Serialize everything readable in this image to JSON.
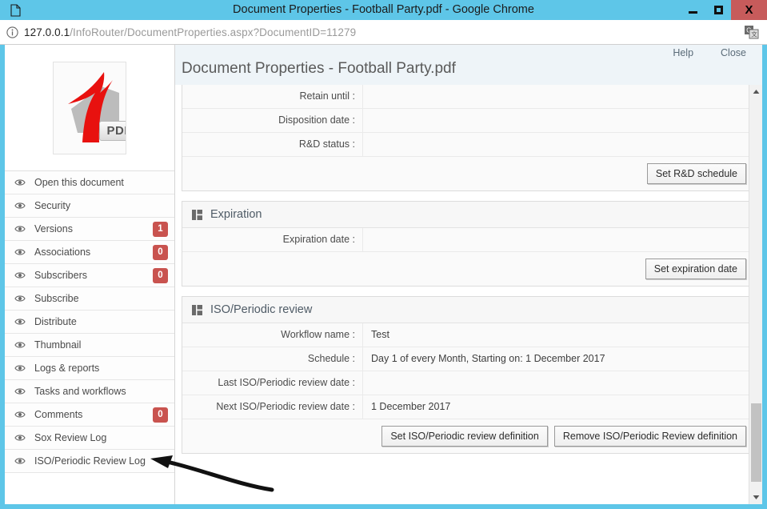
{
  "browser": {
    "window_title": "Document Properties - Football Party.pdf - Google Chrome",
    "tab_icon": "document-icon",
    "minimize_label": "",
    "maximize_label": "",
    "close_label": "X",
    "url_host": "127.0.0.1",
    "url_path": "/InfoRouter/DocumentProperties.aspx?DocumentID=11279",
    "url_info_icon": "info-circle-icon",
    "url_right_icon": "translate-icon",
    "titlebar_color": "#5ec6e8",
    "close_button_color": "#c75b5b"
  },
  "sidebar": {
    "thumbnail": {
      "type": "pdf-thumbnail",
      "badge_label": "PDF"
    },
    "items": [
      {
        "label": "Open this document",
        "icon": "eye-icon",
        "badge": null
      },
      {
        "label": "Security",
        "icon": "eye-icon",
        "badge": null
      },
      {
        "label": "Versions",
        "icon": "eye-icon",
        "badge": "1"
      },
      {
        "label": "Associations",
        "icon": "eye-icon",
        "badge": "0"
      },
      {
        "label": "Subscribers",
        "icon": "eye-icon",
        "badge": "0"
      },
      {
        "label": "Subscribe",
        "icon": "eye-icon",
        "badge": null
      },
      {
        "label": "Distribute",
        "icon": "eye-icon",
        "badge": null
      },
      {
        "label": "Thumbnail",
        "icon": "eye-icon",
        "badge": null
      },
      {
        "label": "Logs & reports",
        "icon": "eye-icon",
        "badge": null
      },
      {
        "label": "Tasks and workflows",
        "icon": "eye-icon",
        "badge": null
      },
      {
        "label": "Comments",
        "icon": "eye-icon",
        "badge": "0"
      },
      {
        "label": "Sox Review Log",
        "icon": "eye-icon",
        "badge": null
      },
      {
        "label": "ISO/Periodic Review Log",
        "icon": "eye-icon",
        "badge": null
      }
    ],
    "badge_color": "#c9534f"
  },
  "header": {
    "title": "Document Properties - Football Party.pdf",
    "help_label": "Help",
    "close_label": "Close"
  },
  "panels": {
    "retention": {
      "rows": [
        {
          "label": "Retain until :",
          "value": ""
        },
        {
          "label": "Disposition date :",
          "value": ""
        },
        {
          "label": "R&D status :",
          "value": ""
        }
      ],
      "buttons": [
        "Set R&D schedule"
      ]
    },
    "expiration": {
      "title": "Expiration",
      "icon": "panel-grid-icon",
      "rows": [
        {
          "label": "Expiration date :",
          "value": ""
        }
      ],
      "buttons": [
        "Set expiration date"
      ]
    },
    "iso_review": {
      "title": "ISO/Periodic review",
      "icon": "panel-grid-icon",
      "rows": [
        {
          "label": "Workflow name :",
          "value": "Test"
        },
        {
          "label": "Schedule :",
          "value": "Day 1 of every Month, Starting on: 1 December 2017"
        },
        {
          "label": "Last ISO/Periodic review date :",
          "value": ""
        },
        {
          "label": "Next ISO/Periodic review date :",
          "value": "1 December 2017"
        }
      ],
      "buttons": [
        "Set ISO/Periodic review definition",
        "Remove ISO/Periodic Review definition"
      ]
    }
  },
  "scrollbar": {
    "up_arrow_icon": "triangle-up-icon",
    "down_arrow_icon": "triangle-down-icon"
  },
  "annotation": {
    "type": "curved-arrow",
    "points_to": "ISO/Periodic Review Log"
  }
}
